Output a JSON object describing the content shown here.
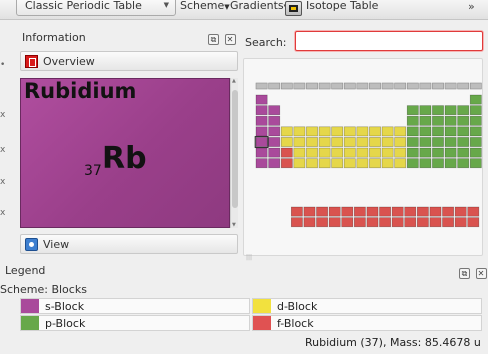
{
  "toolbar": {
    "table_select": "Classic Periodic Table",
    "scheme_menu": "Scheme",
    "gradients_menu": "Gradients",
    "isotope_table": "Isotope Table",
    "more": "»"
  },
  "information": {
    "title": "Information",
    "overview_label": "Overview",
    "view_label": "View",
    "element": {
      "name": "Rubidium",
      "number": "37",
      "symbol": "Rb",
      "block_color": "#a64598"
    }
  },
  "search": {
    "label": "Search:",
    "value": "",
    "placeholder": ""
  },
  "periodic_table": {
    "highlighted_symbol": "Rb",
    "colors": {
      "s": "#a94a9b",
      "p": "#67a84a",
      "d": "#e5d74a",
      "f": "#d9534f"
    }
  },
  "legend": {
    "title": "Legend",
    "scheme_label": "Scheme: Blocks",
    "items": [
      {
        "label": "s-Block",
        "color": "#a94a9b"
      },
      {
        "label": "d-Block",
        "color": "#f2e13e"
      },
      {
        "label": "p-Block",
        "color": "#67a84a"
      },
      {
        "label": "f-Block",
        "color": "#e05252"
      }
    ]
  },
  "status": {
    "text": "Rubidium (37), Mass: 85.4678 u"
  },
  "icons": {
    "dock_float": "⧉",
    "dock_close": "✕"
  }
}
